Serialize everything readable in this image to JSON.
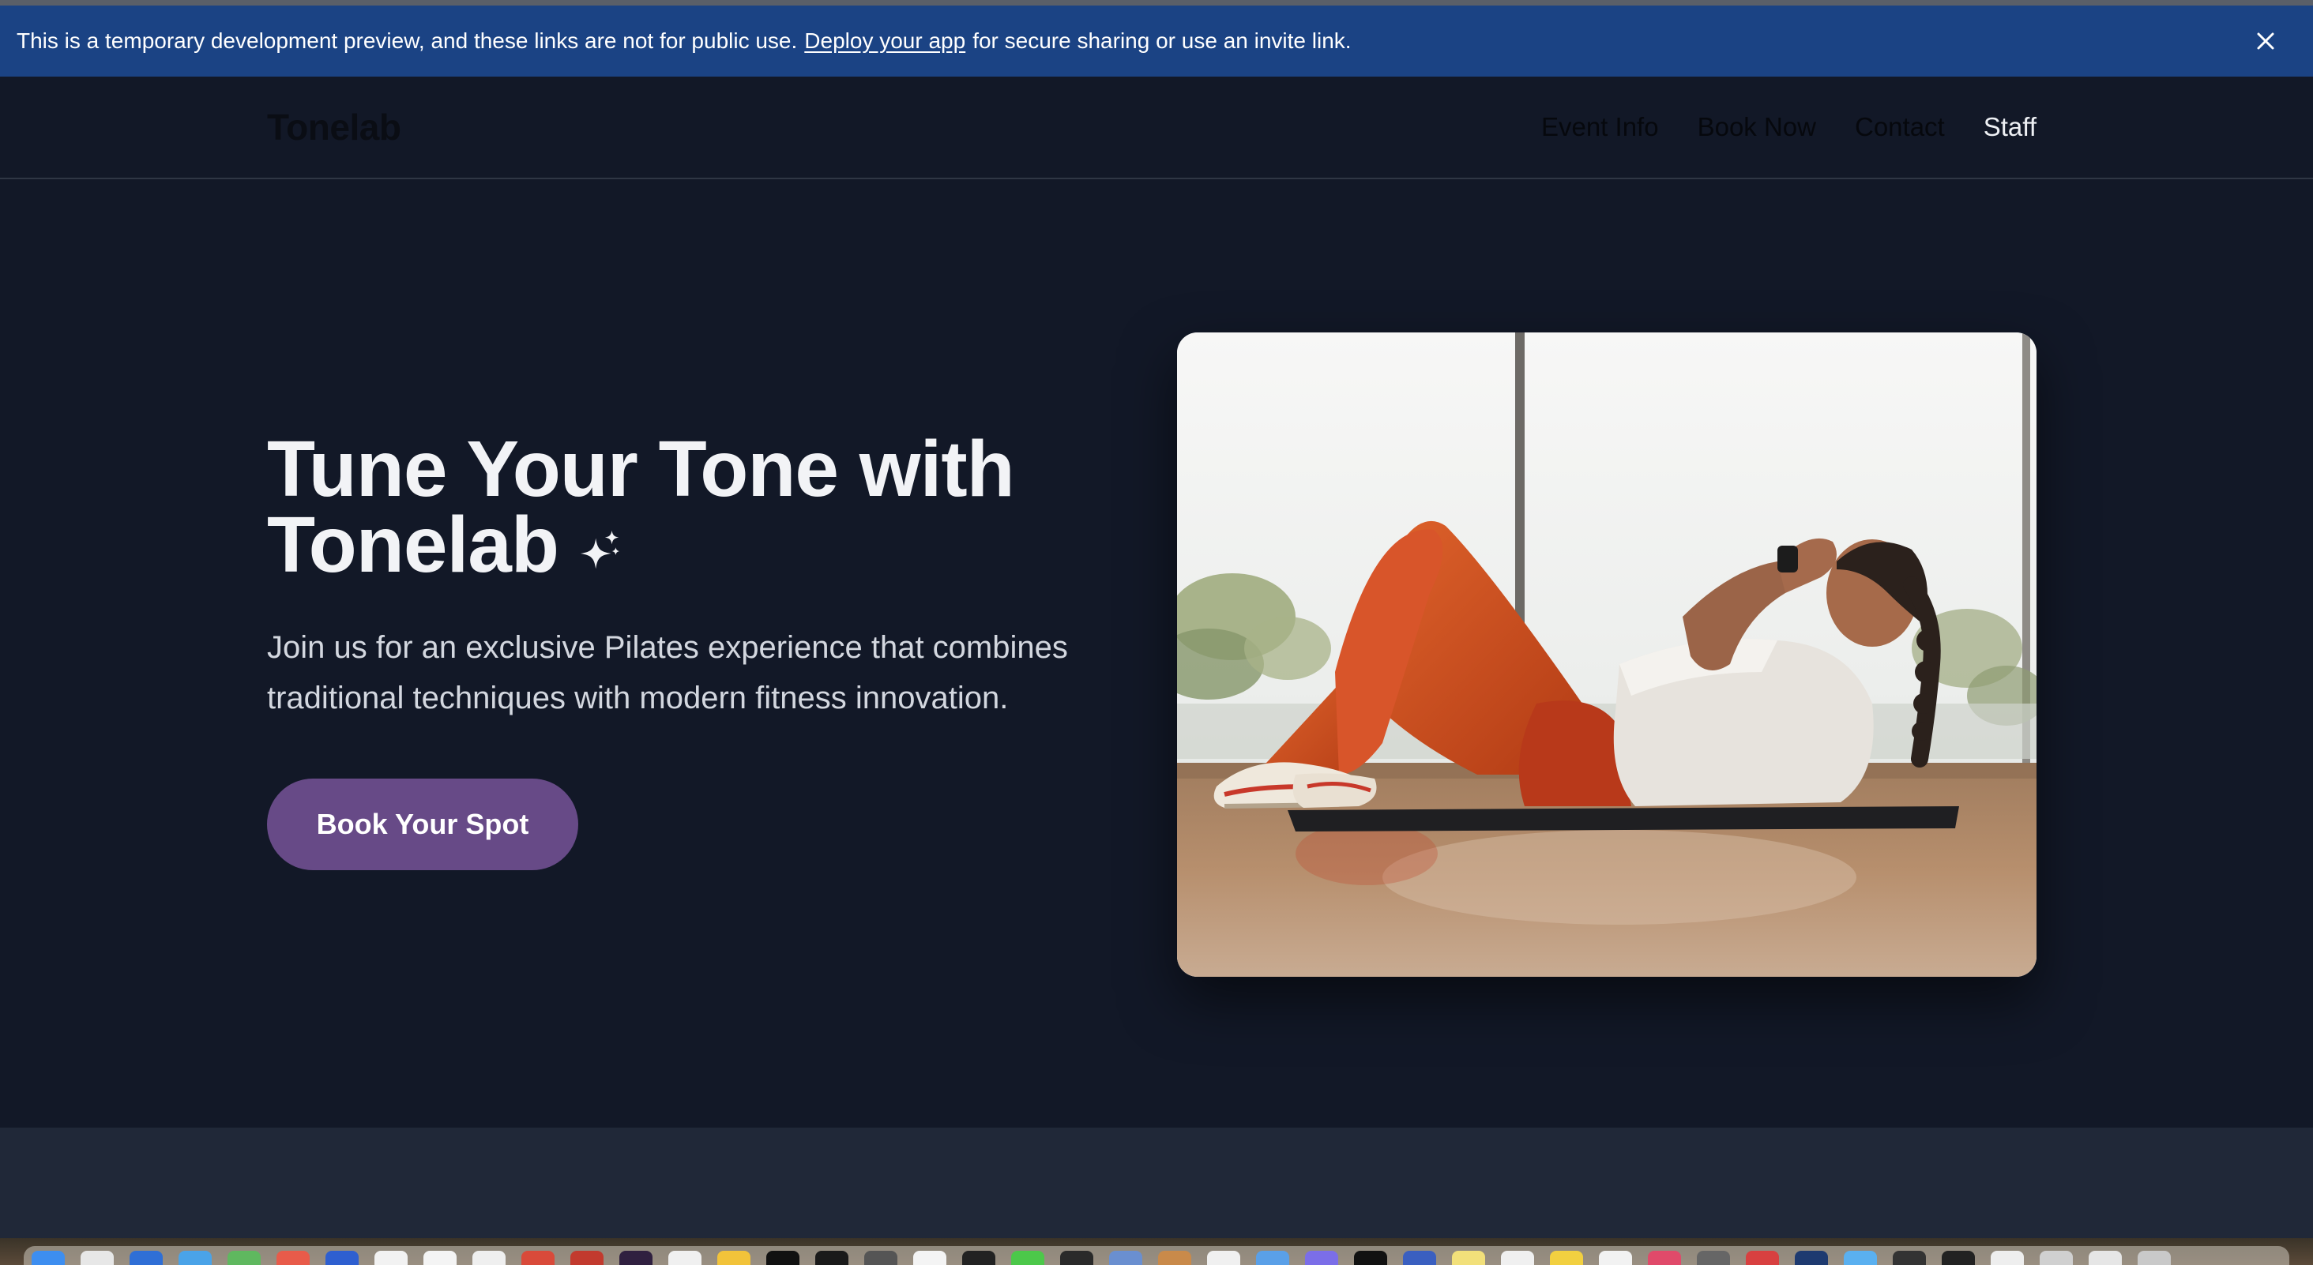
{
  "banner": {
    "text_before": "This is a temporary development preview, and these links are not for public use.",
    "link_label": "Deploy your app",
    "text_after": "for secure sharing or use an invite link.",
    "close_icon": "close-icon",
    "background": "#1b4384"
  },
  "header": {
    "logo": "Tonelab",
    "nav": [
      {
        "label": "Event Info"
      },
      {
        "label": "Book Now"
      },
      {
        "label": "Contact"
      },
      {
        "label": "Staff"
      }
    ]
  },
  "hero": {
    "title_line1": "Tune Your Tone with",
    "title_line2": "Tonelab",
    "title_icon": "sparkles-icon",
    "subtitle": "Join us for an exclusive Pilates experience that combines traditional techniques with modern fitness innovation.",
    "cta_label": "Book Your Spot",
    "cta_color": "#674a87",
    "image": "woman-doing-crunches-photo"
  },
  "colors": {
    "page_background": "#121827",
    "section_background": "#202838"
  },
  "dock": {
    "icons": [
      "finder-icon",
      "launchpad-icon",
      "mail-icon",
      "safari-icon",
      "maps-icon",
      "calendar-icon",
      "app-icon",
      "notes-icon",
      "reminders-icon",
      "app-icon",
      "app-icon",
      "app-icon",
      "app-icon",
      "app-icon",
      "terminal-icon",
      "app-icon",
      "app-icon",
      "app-icon",
      "app-icon",
      "messages-icon",
      "app-icon",
      "app-icon",
      "app-icon",
      "app-icon",
      "app-icon",
      "app-icon",
      "app-icon",
      "app-icon",
      "app-icon",
      "app-icon",
      "app-icon",
      "app-icon",
      "app-icon",
      "app-icon",
      "app-icon",
      "app-icon",
      "app-icon",
      "app-icon",
      "app-icon",
      "app-icon",
      "app-icon",
      "app-icon",
      "app-icon",
      "trash-icon"
    ]
  }
}
